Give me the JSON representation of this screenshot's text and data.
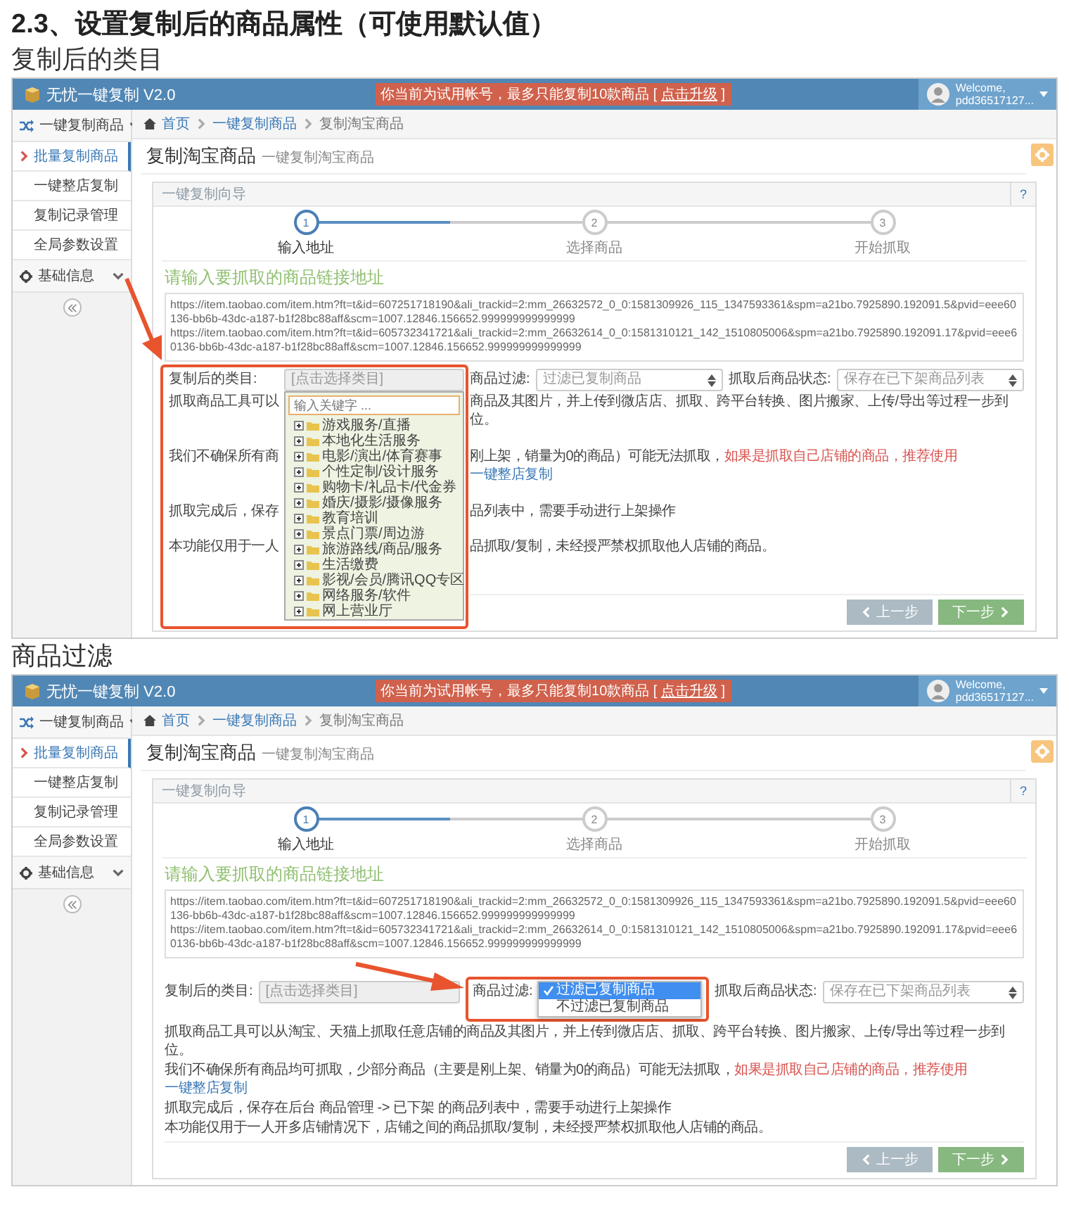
{
  "heading": "2.3、设置复制后的商品属性（可使用默认值）",
  "sections": [
    {
      "caption": "复制后的类目",
      "screen": {
        "app_title": "无忧一键复制 V2.0",
        "notice": {
          "text": "你当前为试用帐号，最多只能复制10款商品 [",
          "link": "点击升级",
          "after": "]"
        },
        "user": {
          "greeting": "Welcome,",
          "name": "pdd36517127..."
        },
        "sidebar": [
          {
            "label": "一键复制商品",
            "items": [
              {
                "label": "批量复制商品",
                "selected": true
              },
              {
                "label": "一键整店复制",
                "selected": false
              },
              {
                "label": "复制记录管理",
                "selected": false
              },
              {
                "label": "全局参数设置",
                "selected": false
              }
            ]
          },
          {
            "label": "基础信息"
          }
        ],
        "breadcrumb": [
          "首页",
          "一键复制商品",
          "复制淘宝商品"
        ],
        "page_title": "复制淘宝商品",
        "page_subtitle": "一键复制淘宝商品",
        "wizard": {
          "title": "一键复制向导",
          "help": "?",
          "steps": [
            {
              "number": "1",
              "label": "输入地址",
              "selected": true
            },
            {
              "number": "2",
              "label": "选择商品",
              "selected": false
            },
            {
              "number": "3",
              "label": "开始抓取",
              "selected": false
            }
          ],
          "url_prompt": "请输入要抓取的商品链接地址",
          "urls": "https://item.taobao.com/item.htm?ft=t&id=607251718190&ali_trackid=2:mm_26632572_0_0:1581309926_115_1347593361&spm=a21bo.7925890.192091.5&pvid=eee60136-bb6b-43dc-a187-b1f28bc88aff&scm=1007.12846.156652.999999999999999\nhttps://item.taobao.com/item.htm?ft=t&id=605732341721&ali_trackid=2:mm_26632614_0_0:1581310121_142_1510805006&spm=a21bo.7925890.192091.17&pvid=eee60136-bb6b-43dc-a187-b1f28bc88aff&scm=1007.12846.156652.999999999999999",
          "category_label": "复制后的类目:",
          "category_placeholder": "[点击选择类目]",
          "filter_label": "商品过滤:",
          "filter_value": "过滤已复制商品",
          "status_label": "抓取后商品状态:",
          "status_value": "保存在已下架商品列表",
          "info_lines": [
            {
              "left": "抓取商品工具可以",
              "text": "商品及其图片，并上传到微店店、抓取、跨平台转换、图片搬家、上传/导出等过程一步到位。"
            },
            {
              "left": "我们不确保所有商",
              "text": "刚上架，销量为0的商品）可能无法抓取，",
              "warning": "如果是抓取自己店铺的商品，推荐使用",
              "link": "一键整店复制"
            },
            {
              "left": "抓取完成后，保存",
              "text": "品列表中，需要手动进行上架操作"
            },
            {
              "left": "本功能仅用于一人",
              "text": "品抓取/复制，未经授严禁权抓取他人店铺的商品。"
            }
          ],
          "prev_button": "上一步",
          "next_button": "下一步"
        },
        "open_menu": {
          "kind": "category_tree",
          "search_placeholder": "输入关键字 ...",
          "items": [
            {
              "label": "游戏服务/直播"
            },
            {
              "label": "本地化生活服务"
            },
            {
              "label": "电影/演出/体育赛事"
            },
            {
              "label": "个性定制/设计服务"
            },
            {
              "label": "购物卡/礼品卡/代金券"
            },
            {
              "label": "婚庆/摄影/摄像服务"
            },
            {
              "label": "教育培训"
            },
            {
              "label": "景点门票/周边游"
            },
            {
              "label": "旅游路线/商品/服务"
            },
            {
              "label": "生活缴费"
            },
            {
              "label": "影视/会员/腾讯QQ专区"
            },
            {
              "label": "网络服务/软件"
            },
            {
              "label": "网上营业厅"
            }
          ]
        }
      }
    },
    {
      "caption": "商品过滤",
      "screen": {
        "app_title": "无忧一键复制 V2.0",
        "notice": {
          "text": "你当前为试用帐号，最多只能复制10款商品 [",
          "link": "点击升级",
          "after": "]"
        },
        "user": {
          "greeting": "Welcome,",
          "name": "pdd36517127..."
        },
        "sidebar": [
          {
            "label": "一键复制商品",
            "items": [
              {
                "label": "批量复制商品",
                "selected": true
              },
              {
                "label": "一键整店复制",
                "selected": false
              },
              {
                "label": "复制记录管理",
                "selected": false
              },
              {
                "label": "全局参数设置",
                "selected": false
              }
            ]
          },
          {
            "label": "基础信息"
          }
        ],
        "breadcrumb": [
          "首页",
          "一键复制商品",
          "复制淘宝商品"
        ],
        "page_title": "复制淘宝商品",
        "page_subtitle": "一键复制淘宝商品",
        "wizard": {
          "title": "一键复制向导",
          "help": "?",
          "steps": [
            {
              "number": "1",
              "label": "输入地址",
              "selected": true
            },
            {
              "number": "2",
              "label": "选择商品",
              "selected": false
            },
            {
              "number": "3",
              "label": "开始抓取",
              "selected": false
            }
          ],
          "url_prompt": "请输入要抓取的商品链接地址",
          "urls": "https://item.taobao.com/item.htm?ft=t&id=607251718190&ali_trackid=2:mm_26632572_0_0:1581309926_115_1347593361&spm=a21bo.7925890.192091.5&pvid=eee60136-bb6b-43dc-a187-b1f28bc88aff&scm=1007.12846.156652.999999999999999\nhttps://item.taobao.com/item.htm?ft=t&id=605732341721&ali_trackid=2:mm_26632614_0_0:1581310121_142_1510805006&spm=a21bo.7925890.192091.17&pvid=eee60136-bb6b-43dc-a187-b1f28bc88aff&scm=1007.12846.156652.999999999999999",
          "category_label": "复制后的类目:",
          "category_placeholder": "[点击选择类目]",
          "filter_label": "商品过滤:",
          "status_label": "抓取后商品状态:",
          "status_value": "保存在已下架商品列表",
          "info_lines": [
            {
              "text": "抓取商品工具可以从淘宝、天猫上抓取任意店铺的商品及其图片，并上传到微店店、抓取、跨平台转换、图片搬家、上传/导出等过程一步到位。"
            },
            {
              "text": "我们不确保所有商品均可抓取，少部分商品（主要是刚上架、销量为0的商品）可能无法抓取，",
              "warning": "如果是抓取自己店铺的商品，推荐使用",
              "link": "一键整店复制"
            },
            {
              "text": "抓取完成后，保存在后台 商品管理 -> 已下架 的商品列表中，需要手动进行上架操作"
            },
            {
              "text": "本功能仅用于一人开多店铺情况下，店铺之间的商品抓取/复制，未经授严禁权抓取他人店铺的商品。"
            }
          ],
          "prev_button": "上一步",
          "next_button": "下一步"
        },
        "open_menu": {
          "kind": "filter_options",
          "options": [
            {
              "label": "过滤已复制商品",
              "selected": true
            },
            {
              "label": "不过滤已复制商品",
              "selected": false
            }
          ]
        }
      }
    }
  ]
}
